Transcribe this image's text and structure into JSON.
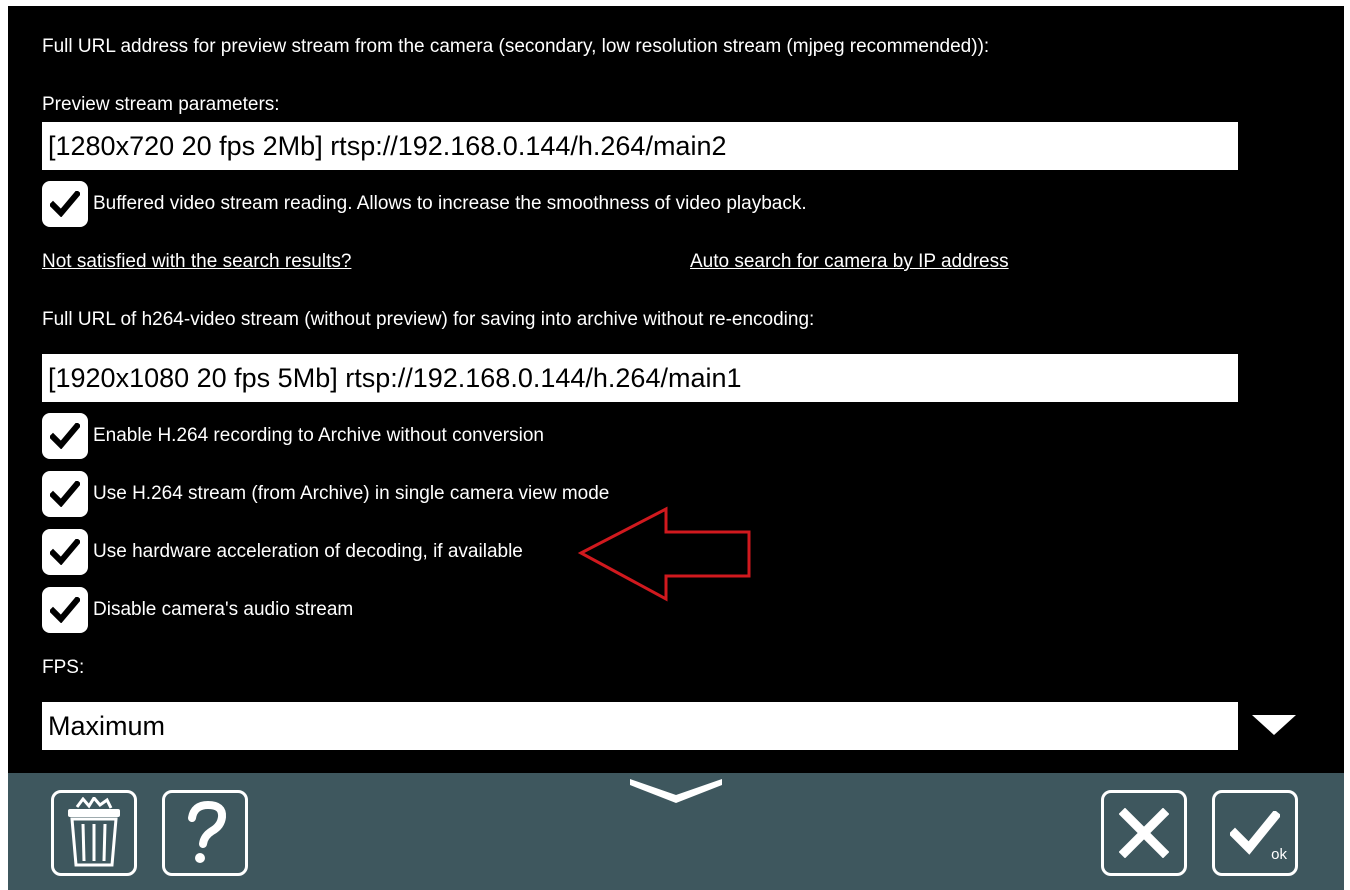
{
  "form": {
    "preview_url_label": "Full URL address for preview stream from the camera (secondary, low resolution stream (mjpeg recommended)):",
    "preview_params_label": "Preview stream parameters:",
    "preview_params_value": "[1280x720 20 fps 2Mb] rtsp://192.168.0.144/h.264/main2",
    "buffered_label": "Buffered video stream reading. Allows to increase the smoothness of video playback.",
    "buffered_checked": true,
    "not_satisfied_link": "Not satisfied with the search results?",
    "auto_search_link": "Auto search for camera by IP address",
    "h264_url_label": "Full URL of h264-video stream (without preview) for saving into archive without re-encoding:",
    "h264_url_value": "[1920x1080 20 fps 5Mb] rtsp://192.168.0.144/h.264/main1",
    "checkboxes": [
      {
        "label": "Enable H.264 recording to Archive without conversion",
        "checked": true
      },
      {
        "label": "Use H.264 stream (from Archive) in single camera view mode",
        "checked": true
      },
      {
        "label": "Use hardware acceleration of decoding, if available",
        "checked": true
      },
      {
        "label": "Disable camera's audio stream",
        "checked": true
      }
    ],
    "fps_label": "FPS:",
    "fps_value": "Maximum"
  },
  "toolbar": {
    "delete_icon": "trash-icon",
    "help_icon": "help-icon",
    "cancel_icon": "close-icon",
    "ok_icon": "checkmark-icon",
    "ok_sublabel": "ok"
  },
  "colors": {
    "panel_bg": "#000000",
    "toolbar_bg": "#3e575e",
    "annotation_arrow": "#d0191e"
  }
}
